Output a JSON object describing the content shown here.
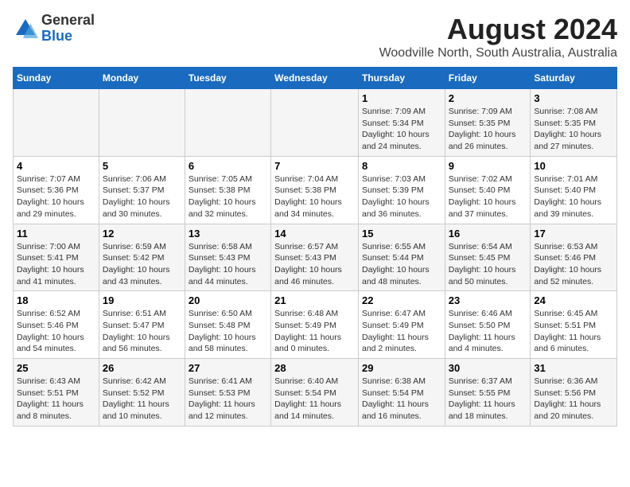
{
  "logo": {
    "general": "General",
    "blue": "Blue"
  },
  "title": "August 2024",
  "subtitle": "Woodville North, South Australia, Australia",
  "days_of_week": [
    "Sunday",
    "Monday",
    "Tuesday",
    "Wednesday",
    "Thursday",
    "Friday",
    "Saturday"
  ],
  "weeks": [
    [
      {
        "day": "",
        "info": ""
      },
      {
        "day": "",
        "info": ""
      },
      {
        "day": "",
        "info": ""
      },
      {
        "day": "",
        "info": ""
      },
      {
        "day": "1",
        "info": "Sunrise: 7:09 AM\nSunset: 5:34 PM\nDaylight: 10 hours\nand 24 minutes."
      },
      {
        "day": "2",
        "info": "Sunrise: 7:09 AM\nSunset: 5:35 PM\nDaylight: 10 hours\nand 26 minutes."
      },
      {
        "day": "3",
        "info": "Sunrise: 7:08 AM\nSunset: 5:35 PM\nDaylight: 10 hours\nand 27 minutes."
      }
    ],
    [
      {
        "day": "4",
        "info": "Sunrise: 7:07 AM\nSunset: 5:36 PM\nDaylight: 10 hours\nand 29 minutes."
      },
      {
        "day": "5",
        "info": "Sunrise: 7:06 AM\nSunset: 5:37 PM\nDaylight: 10 hours\nand 30 minutes."
      },
      {
        "day": "6",
        "info": "Sunrise: 7:05 AM\nSunset: 5:38 PM\nDaylight: 10 hours\nand 32 minutes."
      },
      {
        "day": "7",
        "info": "Sunrise: 7:04 AM\nSunset: 5:38 PM\nDaylight: 10 hours\nand 34 minutes."
      },
      {
        "day": "8",
        "info": "Sunrise: 7:03 AM\nSunset: 5:39 PM\nDaylight: 10 hours\nand 36 minutes."
      },
      {
        "day": "9",
        "info": "Sunrise: 7:02 AM\nSunset: 5:40 PM\nDaylight: 10 hours\nand 37 minutes."
      },
      {
        "day": "10",
        "info": "Sunrise: 7:01 AM\nSunset: 5:40 PM\nDaylight: 10 hours\nand 39 minutes."
      }
    ],
    [
      {
        "day": "11",
        "info": "Sunrise: 7:00 AM\nSunset: 5:41 PM\nDaylight: 10 hours\nand 41 minutes."
      },
      {
        "day": "12",
        "info": "Sunrise: 6:59 AM\nSunset: 5:42 PM\nDaylight: 10 hours\nand 43 minutes."
      },
      {
        "day": "13",
        "info": "Sunrise: 6:58 AM\nSunset: 5:43 PM\nDaylight: 10 hours\nand 44 minutes."
      },
      {
        "day": "14",
        "info": "Sunrise: 6:57 AM\nSunset: 5:43 PM\nDaylight: 10 hours\nand 46 minutes."
      },
      {
        "day": "15",
        "info": "Sunrise: 6:55 AM\nSunset: 5:44 PM\nDaylight: 10 hours\nand 48 minutes."
      },
      {
        "day": "16",
        "info": "Sunrise: 6:54 AM\nSunset: 5:45 PM\nDaylight: 10 hours\nand 50 minutes."
      },
      {
        "day": "17",
        "info": "Sunrise: 6:53 AM\nSunset: 5:46 PM\nDaylight: 10 hours\nand 52 minutes."
      }
    ],
    [
      {
        "day": "18",
        "info": "Sunrise: 6:52 AM\nSunset: 5:46 PM\nDaylight: 10 hours\nand 54 minutes."
      },
      {
        "day": "19",
        "info": "Sunrise: 6:51 AM\nSunset: 5:47 PM\nDaylight: 10 hours\nand 56 minutes."
      },
      {
        "day": "20",
        "info": "Sunrise: 6:50 AM\nSunset: 5:48 PM\nDaylight: 10 hours\nand 58 minutes."
      },
      {
        "day": "21",
        "info": "Sunrise: 6:48 AM\nSunset: 5:49 PM\nDaylight: 11 hours\nand 0 minutes."
      },
      {
        "day": "22",
        "info": "Sunrise: 6:47 AM\nSunset: 5:49 PM\nDaylight: 11 hours\nand 2 minutes."
      },
      {
        "day": "23",
        "info": "Sunrise: 6:46 AM\nSunset: 5:50 PM\nDaylight: 11 hours\nand 4 minutes."
      },
      {
        "day": "24",
        "info": "Sunrise: 6:45 AM\nSunset: 5:51 PM\nDaylight: 11 hours\nand 6 minutes."
      }
    ],
    [
      {
        "day": "25",
        "info": "Sunrise: 6:43 AM\nSunset: 5:51 PM\nDaylight: 11 hours\nand 8 minutes."
      },
      {
        "day": "26",
        "info": "Sunrise: 6:42 AM\nSunset: 5:52 PM\nDaylight: 11 hours\nand 10 minutes."
      },
      {
        "day": "27",
        "info": "Sunrise: 6:41 AM\nSunset: 5:53 PM\nDaylight: 11 hours\nand 12 minutes."
      },
      {
        "day": "28",
        "info": "Sunrise: 6:40 AM\nSunset: 5:54 PM\nDaylight: 11 hours\nand 14 minutes."
      },
      {
        "day": "29",
        "info": "Sunrise: 6:38 AM\nSunset: 5:54 PM\nDaylight: 11 hours\nand 16 minutes."
      },
      {
        "day": "30",
        "info": "Sunrise: 6:37 AM\nSunset: 5:55 PM\nDaylight: 11 hours\nand 18 minutes."
      },
      {
        "day": "31",
        "info": "Sunrise: 6:36 AM\nSunset: 5:56 PM\nDaylight: 11 hours\nand 20 minutes."
      }
    ]
  ]
}
